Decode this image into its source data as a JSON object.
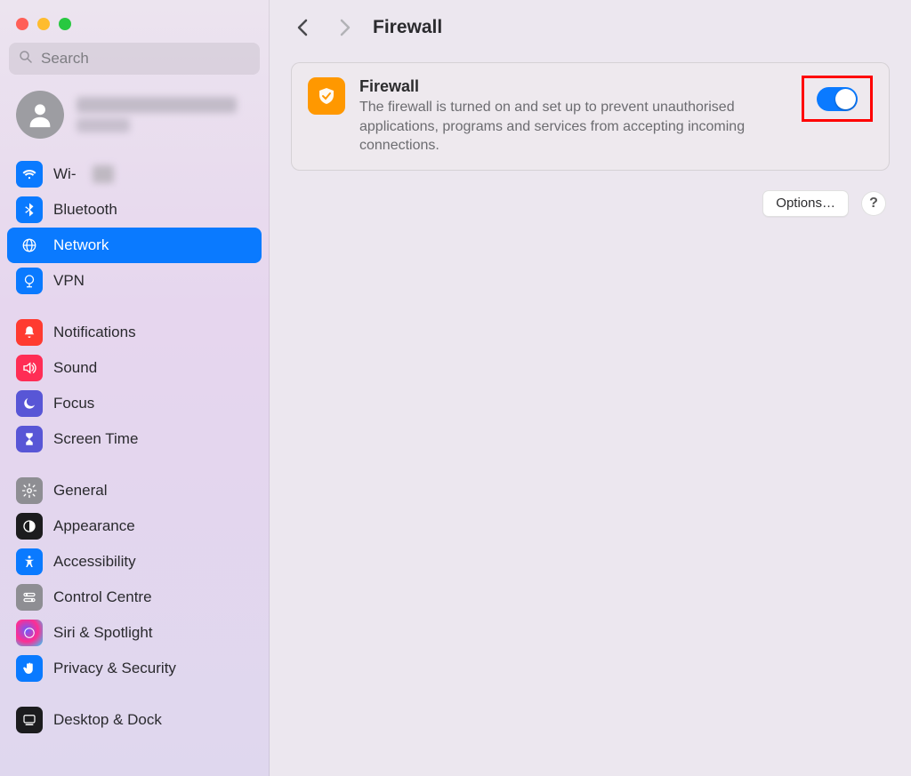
{
  "search": {
    "placeholder": "Search"
  },
  "header": {
    "title": "Firewall"
  },
  "sidebar": {
    "items": [
      {
        "label": "Wi-",
        "icon": "wifi-icon",
        "bg": "#0a7aff"
      },
      {
        "label": "Bluetooth",
        "icon": "bluetooth-icon",
        "bg": "#0a7aff"
      },
      {
        "label": "Network",
        "icon": "globe-icon",
        "bg": "#0a7aff",
        "selected": true
      },
      {
        "label": "VPN",
        "icon": "vpn-icon",
        "bg": "#0a7aff"
      }
    ],
    "group2": [
      {
        "label": "Notifications",
        "icon": "bell-icon",
        "bg": "#ff3b30"
      },
      {
        "label": "Sound",
        "icon": "speaker-icon",
        "bg": "#ff2d55"
      },
      {
        "label": "Focus",
        "icon": "moon-icon",
        "bg": "#5856d6"
      },
      {
        "label": "Screen Time",
        "icon": "hourglass-icon",
        "bg": "#5856d6"
      }
    ],
    "group3": [
      {
        "label": "General",
        "icon": "gear-icon",
        "bg": "#8e8e93"
      },
      {
        "label": "Appearance",
        "icon": "appearance-icon",
        "bg": "#1c1c1e"
      },
      {
        "label": "Accessibility",
        "icon": "accessibility-icon",
        "bg": "#0a7aff"
      },
      {
        "label": "Control Centre",
        "icon": "switches-icon",
        "bg": "#8e8e93"
      },
      {
        "label": "Siri & Spotlight",
        "icon": "siri-icon",
        "bg": "#1c1c1e"
      },
      {
        "label": "Privacy & Security",
        "icon": "hand-icon",
        "bg": "#0a7aff"
      }
    ],
    "group4": [
      {
        "label": "Desktop & Dock",
        "icon": "dock-icon",
        "bg": "#1c1c1e"
      }
    ]
  },
  "firewall_card": {
    "title": "Firewall",
    "desc": "The firewall is turned on and set up to prevent unauthorised applications, programs and services from accepting incoming connections.",
    "toggle_on": true
  },
  "actions": {
    "options_label": "Options…",
    "help_label": "?"
  },
  "colors": {
    "accent": "#0a7aff",
    "highlight_border": "#ff0000"
  }
}
